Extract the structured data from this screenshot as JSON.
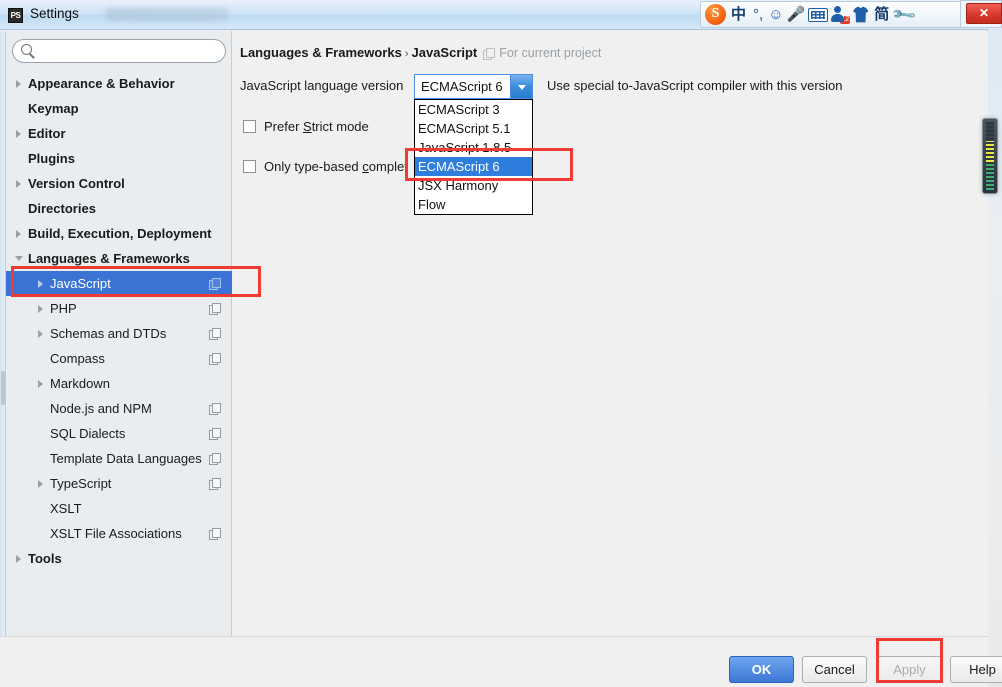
{
  "window": {
    "title": "Settings",
    "icon": "PS",
    "close_label": "✕"
  },
  "ime_toolbar": {
    "logo": "S",
    "items": [
      {
        "name": "chinese-mode",
        "label": "中"
      },
      {
        "name": "punctuation-mode",
        "label": "°,"
      },
      {
        "name": "emoji",
        "label": "☺"
      },
      {
        "name": "voice-input",
        "label": "🎤"
      },
      {
        "name": "soft-keyboard",
        "label": ""
      },
      {
        "name": "user-center",
        "label": "",
        "badge": "12"
      },
      {
        "name": "skin",
        "label": ""
      },
      {
        "name": "simplified-chinese",
        "label": "简"
      },
      {
        "name": "toolbox",
        "label": "🔧"
      }
    ]
  },
  "sidebar": {
    "search": {
      "value": "",
      "placeholder": ""
    },
    "items": [
      {
        "label": "Appearance & Behavior",
        "level": 0,
        "bold": true,
        "arrow": "right",
        "copy": false,
        "selected": false
      },
      {
        "label": "Keymap",
        "level": 0,
        "bold": true,
        "arrow": "none",
        "copy": false,
        "selected": false
      },
      {
        "label": "Editor",
        "level": 0,
        "bold": true,
        "arrow": "right",
        "copy": false,
        "selected": false
      },
      {
        "label": "Plugins",
        "level": 0,
        "bold": true,
        "arrow": "none",
        "copy": false,
        "selected": false
      },
      {
        "label": "Version Control",
        "level": 0,
        "bold": true,
        "arrow": "right",
        "copy": false,
        "selected": false
      },
      {
        "label": "Directories",
        "level": 0,
        "bold": true,
        "arrow": "none",
        "copy": false,
        "selected": false
      },
      {
        "label": "Build, Execution, Deployment",
        "level": 0,
        "bold": true,
        "arrow": "right",
        "copy": false,
        "selected": false
      },
      {
        "label": "Languages & Frameworks",
        "level": 0,
        "bold": true,
        "arrow": "down",
        "copy": false,
        "selected": false
      },
      {
        "label": "JavaScript",
        "level": 1,
        "bold": false,
        "arrow": "right",
        "copy": true,
        "selected": true
      },
      {
        "label": "PHP",
        "level": 1,
        "bold": false,
        "arrow": "right",
        "copy": true,
        "selected": false
      },
      {
        "label": "Schemas and DTDs",
        "level": 1,
        "bold": false,
        "arrow": "right",
        "copy": true,
        "selected": false
      },
      {
        "label": "Compass",
        "level": 1,
        "bold": false,
        "arrow": "none",
        "copy": true,
        "selected": false
      },
      {
        "label": "Markdown",
        "level": 1,
        "bold": false,
        "arrow": "right",
        "copy": false,
        "selected": false
      },
      {
        "label": "Node.js and NPM",
        "level": 1,
        "bold": false,
        "arrow": "none",
        "copy": true,
        "selected": false
      },
      {
        "label": "SQL Dialects",
        "level": 1,
        "bold": false,
        "arrow": "none",
        "copy": true,
        "selected": false
      },
      {
        "label": "Template Data Languages",
        "level": 1,
        "bold": false,
        "arrow": "none",
        "copy": true,
        "selected": false
      },
      {
        "label": "TypeScript",
        "level": 1,
        "bold": false,
        "arrow": "right",
        "copy": true,
        "selected": false
      },
      {
        "label": "XSLT",
        "level": 1,
        "bold": false,
        "arrow": "none",
        "copy": false,
        "selected": false
      },
      {
        "label": "XSLT File Associations",
        "level": 1,
        "bold": false,
        "arrow": "none",
        "copy": true,
        "selected": false
      },
      {
        "label": "Tools",
        "level": 0,
        "bold": true,
        "arrow": "right",
        "copy": false,
        "selected": false
      }
    ]
  },
  "content": {
    "breadcrumb_root": "Languages & Frameworks",
    "breadcrumb_sep": "›",
    "breadcrumb_leaf": "JavaScript",
    "breadcrumb_scope": "For current project",
    "language_version_label": "JavaScript language version",
    "combo_value": "ECMAScript 6",
    "hint": "Use special to-JavaScript compiler with this version",
    "checkbox_strict_pre": "Prefer ",
    "checkbox_strict_u": "S",
    "checkbox_strict_post": "trict mode",
    "checkbox_typebased_pre": "Only type-based ",
    "checkbox_typebased_u": "c",
    "checkbox_typebased_post": "omplet",
    "dropdown_options": [
      {
        "label": "ECMAScript 3",
        "selected": false
      },
      {
        "label": "ECMAScript 5.1",
        "selected": false
      },
      {
        "label": "JavaScript 1.8.5",
        "selected": false
      },
      {
        "label": "ECMAScript 6",
        "selected": true
      },
      {
        "label": "JSX Harmony",
        "selected": false
      },
      {
        "label": "Flow",
        "selected": false
      }
    ]
  },
  "buttons": {
    "ok": "OK",
    "cancel": "Cancel",
    "apply": "Apply",
    "help": "Help"
  },
  "colors": {
    "accent_blue": "#3b74d4",
    "selection_blue": "#2f7ede",
    "annotation_red": "#ef3b33",
    "panel_gray": "#f0f0f0",
    "sidebar_gray": "#e9edf0"
  }
}
